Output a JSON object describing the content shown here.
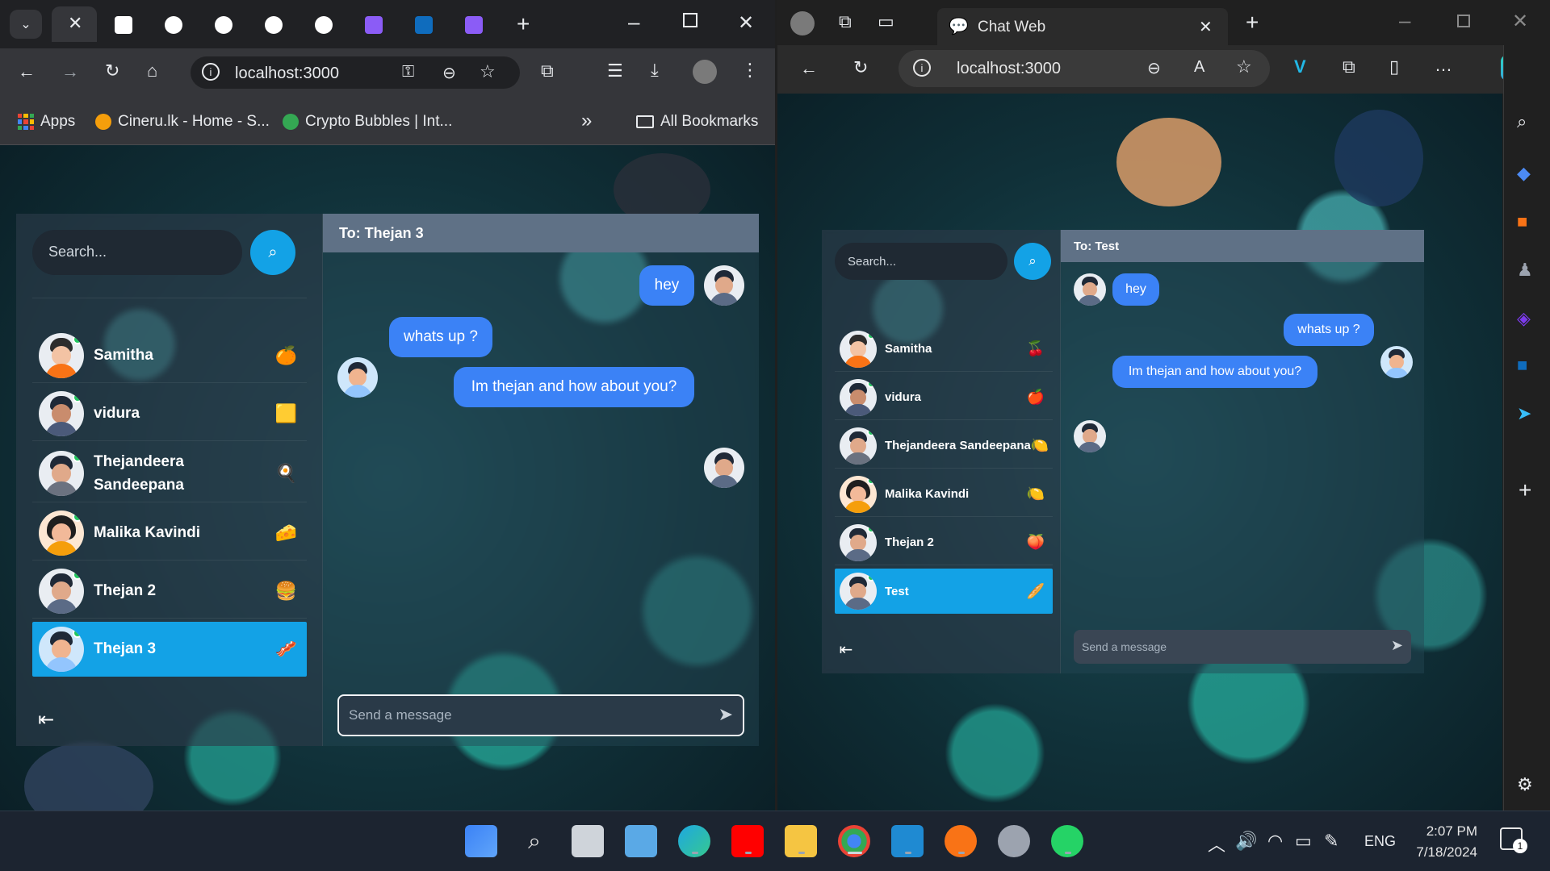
{
  "left_browser": {
    "address": "localhost:3000",
    "bookmarks": [
      "Apps",
      "Cineru.lk - Home - S...",
      "Crypto Bubbles | Int...",
      "All Bookmarks"
    ],
    "overflow_label": "»"
  },
  "left_chat": {
    "search_placeholder": "Search...",
    "header": "To: Thejan 3",
    "contacts": [
      {
        "name": "Samitha",
        "emoji": "🍊"
      },
      {
        "name": "vidura",
        "emoji": "🟨"
      },
      {
        "name": "Thejandeera",
        "name2": "Sandeepana",
        "emoji": "🍳"
      },
      {
        "name": "Malika Kavindi",
        "emoji": "🧀"
      },
      {
        "name": "Thejan 2",
        "emoji": "🍔"
      },
      {
        "name": "Thejan 3",
        "emoji": "🥓"
      }
    ],
    "messages": [
      {
        "text": "hey"
      },
      {
        "text": "whats up ?"
      },
      {
        "text": "Im thejan and how about you?"
      }
    ],
    "input_placeholder": "Send a message"
  },
  "right_browser": {
    "tab_title": "Chat Web",
    "address": "localhost:3000",
    "address_dim": ":3000"
  },
  "right_chat": {
    "search_placeholder": "Search...",
    "header": "To: Test",
    "contacts": [
      {
        "name": "Samitha",
        "emoji": "🍒"
      },
      {
        "name": "vidura",
        "emoji": "🍎"
      },
      {
        "name": "Thejandeera Sandeepana",
        "emoji": "🍋"
      },
      {
        "name": "Malika Kavindi",
        "emoji": "🍋"
      },
      {
        "name": "Thejan 2",
        "emoji": "🍑"
      },
      {
        "name": "Test",
        "emoji": "🥖"
      }
    ],
    "messages": [
      {
        "text": "hey"
      },
      {
        "text": "whats up ?"
      },
      {
        "text": "Im thejan and how about you?"
      }
    ],
    "input_placeholder": "Send a message"
  },
  "taskbar": {
    "language": "ENG",
    "time": "2:07 PM",
    "date": "7/18/2024",
    "notification_count": "1"
  },
  "colors": {
    "accent": "#13a2e6",
    "bubble": "#3b82f6",
    "online": "#22c55e"
  }
}
